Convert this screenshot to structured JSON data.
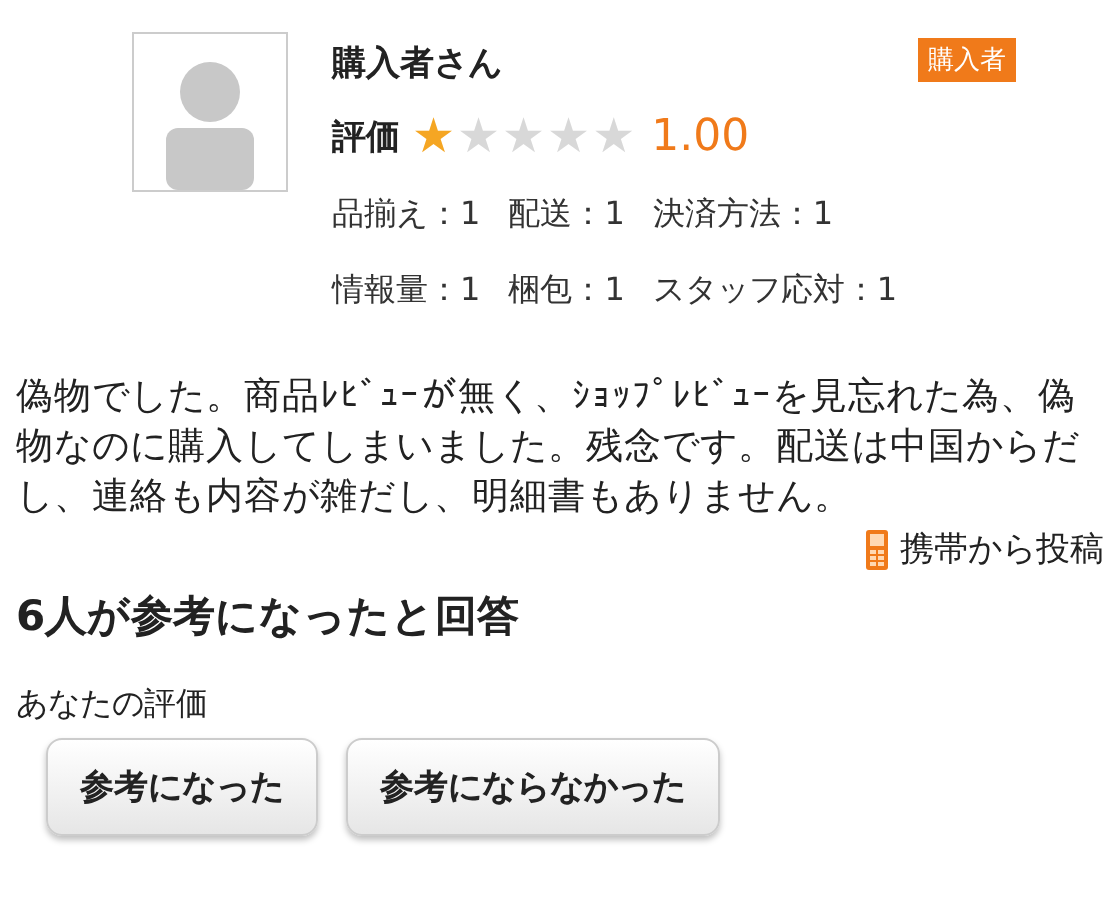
{
  "reviewer": {
    "name": "購入者さん",
    "badge": "購入者"
  },
  "rating": {
    "label": "評価",
    "stars": 1,
    "score": "1.00"
  },
  "details": [
    [
      "品揃え：1",
      "配送：1",
      "決済方法：1"
    ],
    [
      "情報量：1",
      "梱包：1",
      "スタッフ応対：1"
    ]
  ],
  "review_text": "偽物でした。商品ﾚﾋﾞｭｰが無く、ｼｮｯﾌﾟﾚﾋﾞｭｰを見忘れた為、偽物なのに購入してしまいました。残念です。配送は中国からだし、連絡も内容が雑だし、明細書もありません。",
  "posted_from": "携帯から投稿",
  "helpful_summary": "6人が参考になったと回答",
  "your_rating_label": "あなたの評価",
  "buttons": [
    "参考になった",
    "参考にならなかった"
  ]
}
